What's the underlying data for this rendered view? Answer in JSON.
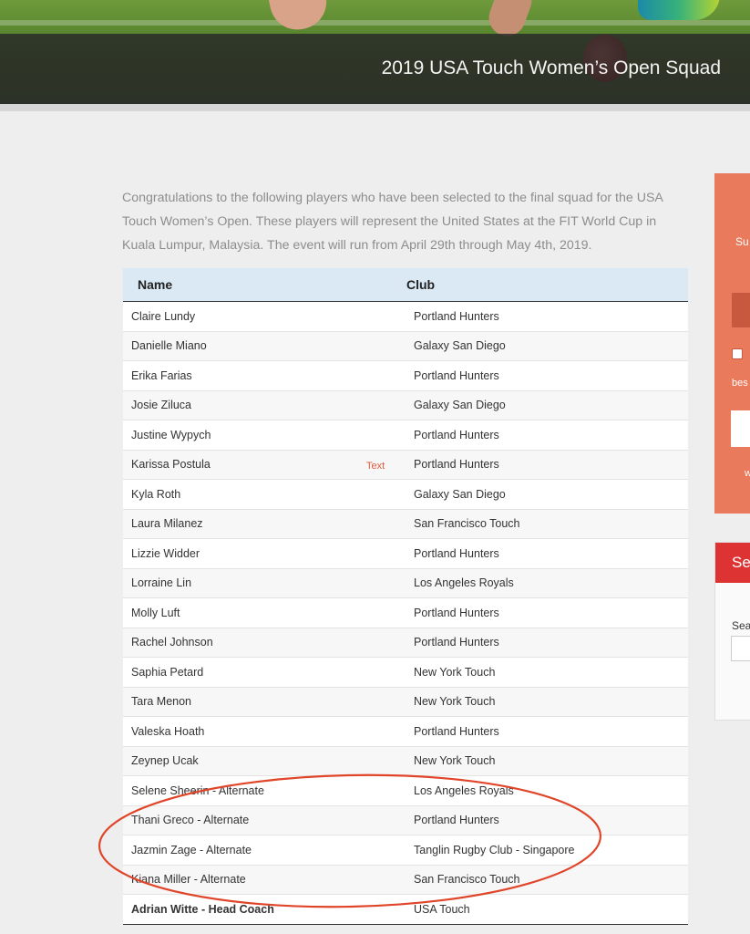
{
  "hero": {
    "title": "2019 USA Touch Women’s Open Squad"
  },
  "intro": "Congratulations to the following players who have been selected  to the final squad for the USA Touch Women’s Open.  These players will represent the United States at the FIT World Cup in Kuala Lumpur, Malaysia.  The event will run from April 29th through May 4th, 2019.",
  "table": {
    "headers": {
      "name": "Name",
      "club": "Club"
    },
    "rows": [
      {
        "name": "Claire Lundy",
        "club": "Portland Hunters"
      },
      {
        "name": "Danielle Miano",
        "club": "Galaxy San Diego"
      },
      {
        "name": "Erika Farias",
        "club": "Portland Hunters"
      },
      {
        "name": "Josie Ziluca",
        "club": "Galaxy San Diego"
      },
      {
        "name": "Justine Wypych",
        "club": "Portland Hunters"
      },
      {
        "name": "Karissa Postula",
        "club": "Portland Hunters"
      },
      {
        "name": "Kyla Roth",
        "club": "Galaxy San Diego"
      },
      {
        "name": "Laura Milanez",
        "club": "San Francisco Touch"
      },
      {
        "name": "Lizzie Widder",
        "club": "Portland Hunters"
      },
      {
        "name": "Lorraine Lin",
        "club": "Los Angeles Royals"
      },
      {
        "name": "Molly Luft",
        "club": "Portland Hunters"
      },
      {
        "name": "Rachel Johnson",
        "club": "Portland Hunters"
      },
      {
        "name": "Saphia Petard",
        "club": "New York Touch"
      },
      {
        "name": "Tara Menon",
        "club": "New York Touch"
      },
      {
        "name": "Valeska Hoath",
        "club": "Portland Hunters"
      },
      {
        "name": "Zeynep Ucak",
        "club": "New York Touch"
      },
      {
        "name": "Selene Sheerin - Alternate",
        "club": "Los Angeles Royals"
      },
      {
        "name": "Thani Greco - Alternate",
        "club": "Portland Hunters"
      },
      {
        "name": "Jazmin Zage - Alternate",
        "club": "Tanglin Rugby Club - Singapore"
      },
      {
        "name": "Kiana Miller - Alternate",
        "club": "San Francisco Touch"
      },
      {
        "name": "Adrian Witte - Head Coach",
        "club": "USA Touch"
      }
    ]
  },
  "text_marker": "Text",
  "sidebar": {
    "signup_text": "Su",
    "consent_text": "bes",
    "footer_text": "w",
    "search_title": "Sea",
    "search_label": "Sea"
  },
  "colors": {
    "annotation_ellipse": "#e0452a",
    "sidebar_orange": "#e97a5c",
    "search_header": "#dd3333",
    "table_header": "#dbe9f5"
  }
}
